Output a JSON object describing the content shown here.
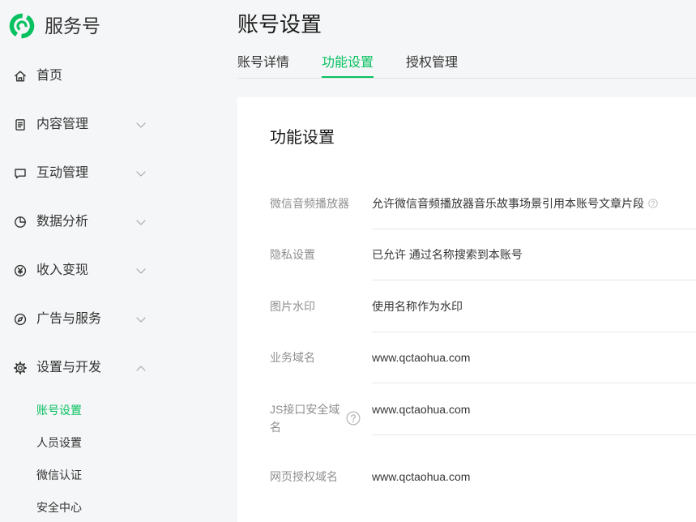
{
  "brand": {
    "name": "服务号",
    "logo_icon": "service-account-logo-icon"
  },
  "colors": {
    "accent": "#07c160",
    "background": "#f5f6f7",
    "card": "#ffffff",
    "text": "#333333",
    "label_gray": "#8f8f8f",
    "divider": "#e7e7eb"
  },
  "sidebar": {
    "items": [
      {
        "label": "首页",
        "icon": "home-icon"
      },
      {
        "label": "内容管理",
        "icon": "document-icon",
        "chevron": "chevron-down-icon"
      },
      {
        "label": "互动管理",
        "icon": "chat-icon",
        "chevron": "chevron-down-icon"
      },
      {
        "label": "数据分析",
        "icon": "pie-chart-icon",
        "chevron": "chevron-down-icon"
      },
      {
        "label": "收入变现",
        "icon": "yen-icon",
        "chevron": "chevron-down-icon"
      },
      {
        "label": "广告与服务",
        "icon": "compass-icon",
        "chevron": "chevron-down-icon"
      },
      {
        "label": "设置与开发",
        "icon": "gear-icon",
        "chevron": "chevron-up-icon",
        "expanded": true
      }
    ],
    "sub_items": [
      {
        "label": "账号设置",
        "active": true
      },
      {
        "label": "人员设置",
        "active": false
      },
      {
        "label": "微信认证",
        "active": false
      },
      {
        "label": "安全中心",
        "active": false
      }
    ]
  },
  "page": {
    "title": "账号设置"
  },
  "tabs": [
    {
      "label": "账号详情",
      "active": false
    },
    {
      "label": "功能设置",
      "active": true
    },
    {
      "label": "授权管理",
      "active": false
    }
  ],
  "section": {
    "title": "功能设置",
    "rows": [
      {
        "label": "微信音频播放器",
        "value": "允许微信音频播放器音乐故事场景引用本账号文章片段",
        "help_icon": "help-icon"
      },
      {
        "label": "隐私设置",
        "value": "已允许 通过名称搜索到本账号"
      },
      {
        "label": "图片水印",
        "value": "使用名称作为水印"
      },
      {
        "label": "业务域名",
        "value": "www.qctaohua.com"
      },
      {
        "label": "JS接口安全域名",
        "value": "www.qctaohua.com",
        "help_icon": "help-icon"
      },
      {
        "label": "网页授权域名",
        "value": "www.qctaohua.com"
      }
    ]
  }
}
